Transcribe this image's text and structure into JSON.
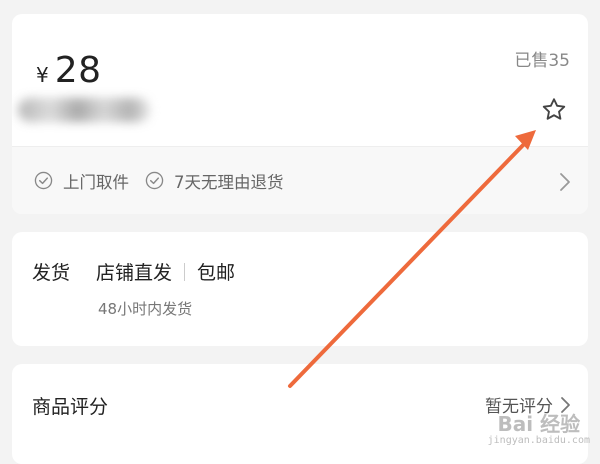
{
  "product": {
    "currency": "¥",
    "price": "28",
    "sold": "已售35",
    "favorite_icon": "star-outline-icon"
  },
  "services": [
    {
      "label": "上门取件",
      "icon": "check-circle-icon"
    },
    {
      "label": "7天无理由退货",
      "icon": "check-circle-icon"
    }
  ],
  "shipping": {
    "label": "发货",
    "tags": [
      "店铺直发",
      "包邮"
    ],
    "time": "48小时内发货"
  },
  "review": {
    "title": "商品评分",
    "status": "暂无评分"
  },
  "annotation": {
    "arrow_color": "#ee6a3c"
  },
  "watermark": {
    "main": "Bai 经验",
    "sub": "jingyan.baidu.com"
  }
}
